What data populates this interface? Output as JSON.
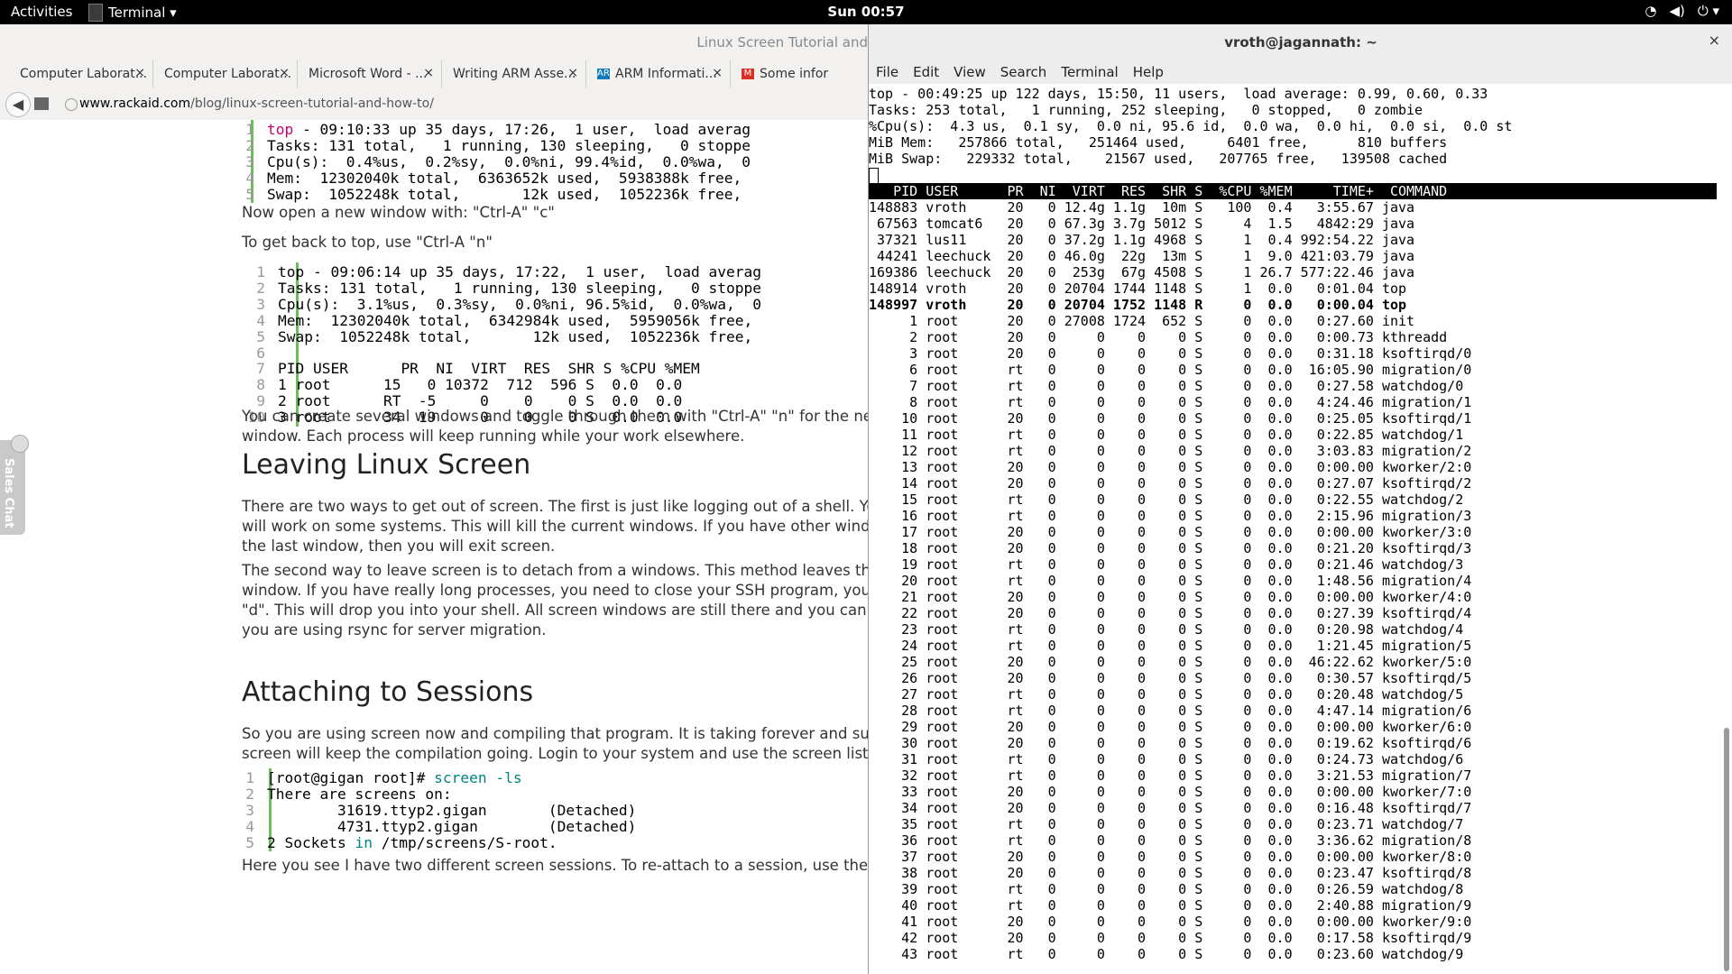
{
  "topbar": {
    "activities": "Activities",
    "app_name": "Terminal ▾",
    "clock": "Sun 00:57",
    "tray": [
      "wifi-icon",
      "volume-icon",
      "power-icon"
    ]
  },
  "browser": {
    "window_title": "Linux Screen Tutorial and",
    "tabs": [
      {
        "label": "Computer Laborat...",
        "fav": "",
        "fav_color": "#ffffff"
      },
      {
        "label": "Computer Laborat...",
        "fav": "",
        "fav_color": "#ffffff"
      },
      {
        "label": "Microsoft Word - ...",
        "fav": "",
        "fav_color": "#ffffff"
      },
      {
        "label": "Writing ARM Asse...",
        "fav": "",
        "fav_color": "#ffffff"
      },
      {
        "label": "ARM Informati...",
        "fav": "ARM",
        "fav_color": "#0e7ab8"
      },
      {
        "label": "Some infor",
        "fav": "M",
        "fav_color": "#d93025"
      }
    ],
    "close_glyph": "×",
    "url_host": "www.rackaid.com",
    "url_path": "/blog/linux-screen-tutorial-and-how-to/",
    "code1": [
      [
        "1",
        "top",
        " - 09:10:33 up 35 days, 17:26,  1 user,  load averag"
      ],
      [
        "2",
        "",
        "Tasks: 131 total,   1 running, 130 sleeping,   0 stoppe"
      ],
      [
        "3",
        "",
        "Cpu(s):  0.4%us,  0.2%sy,  0.0%ni, 99.4%id,  0.0%wa,  0"
      ],
      [
        "4",
        "",
        "Mem:  12302040k total,  6363652k used,  5938388k free,"
      ],
      [
        "5",
        "",
        "Swap:  1052248k total,       12k used,  1052236k free,"
      ]
    ],
    "p1": "Now open a new window with: \"Ctrl-A\" \"c\"",
    "p2": "To get back to top, use \"Ctrl-A \"n\"",
    "code2": [
      [
        "1",
        "top - 09:06:14 up 35 days, 17:22,  1 user,  load averag"
      ],
      [
        "2",
        "Tasks: 131 total,   1 running, 130 sleeping,   0 stoppe"
      ],
      [
        "3",
        "Cpu(s):  3.1%us,  0.3%sy,  0.0%ni, 96.5%id,  0.0%wa,  0"
      ],
      [
        "4",
        "Mem:  12302040k total,  6342984k used,  5959056k free,"
      ],
      [
        "5",
        "Swap:  1052248k total,       12k used,  1052236k free,"
      ],
      [
        "6",
        ""
      ],
      [
        "7",
        "PID USER      PR  NI  VIRT  RES  SHR S %CPU %MEM"
      ],
      [
        "8",
        "1 root      15   0 10372  712  596 S  0.0  0.0"
      ],
      [
        "9",
        "2 root      RT  -5     0    0    0 S  0.0  0.0"
      ],
      [
        "10",
        "3 root      34  19     0    0    0 S  0.0  0.0"
      ]
    ],
    "p3a": "You can create several windows and toggle through them with \"Ctrl-A\" \"n\" for the next windo",
    "p3b": "window. Each process will keep running while your work elsewhere.",
    "h_leaving": "Leaving Linux Screen",
    "p4": [
      "There are two ways to get out of screen. The first is just like logging out of a shell. You kill the",
      "will work on some systems. This will kill the current windows. If you have other windows, you",
      "the last window, then you will exit screen."
    ],
    "p5": [
      "The second way to leave screen is to detach from a windows. This method leaves the proces",
      "window. If you have really long processes, you need to close your SSH program, you can deta",
      "\"d\". This will drop you into your shell. All screen windows are still there and you can re-attach",
      "you are using rsync for server migration."
    ],
    "h_attach": "Attaching to Sessions",
    "p6": [
      "So you are using screen now and compiling that program. It is taking forever and suddenly y",
      "screen will keep the compilation going. Login to your system and use the screen listing tool t"
    ],
    "code3": [
      [
        "1",
        "[root@gigan root]# ",
        "screen -ls"
      ],
      [
        "2",
        "There are screens on:",
        ""
      ],
      [
        "3",
        "        31619.ttyp2.gigan       (Detached)",
        ""
      ],
      [
        "4",
        "        4731.ttyp2.gigan        (Detached)",
        ""
      ],
      [
        "5",
        "2 Sockets ",
        "in",
        " /tmp/screens/S-root."
      ]
    ],
    "p7": "Here you see I have two different screen sessions. To re-attach to a session, use the re-attac",
    "sales_chat": "Sales Chat"
  },
  "terminal": {
    "title": "vroth@jagannath: ~",
    "close": "×",
    "menu": [
      "File",
      "Edit",
      "View",
      "Search",
      "Terminal",
      "Help"
    ],
    "summary": [
      "top - 00:49:25 up 122 days, 15:50, 11 users,  load average: 0.99, 0.60, 0.33",
      "Tasks: 253 total,   1 running, 252 sleeping,   0 stopped,   0 zombie",
      "%Cpu(s):  4.3 us,  0.1 sy,  0.0 ni, 95.6 id,  0.0 wa,  0.0 hi,  0.0 si,  0.0 st",
      "MiB Mem:   257866 total,   251464 used,     6401 free,      810 buffers",
      "MiB Swap:   229332 total,    21567 used,   207765 free,   139508 cached"
    ],
    "header": "   PID USER      PR  NI  VIRT  RES  SHR S  %CPU %MEM     TIME+  COMMAND                                                  ",
    "rows": [
      "148883 vroth     20   0 12.4g 1.1g  10m S   100  0.4   3:55.67 java",
      " 67563 tomcat6   20   0 67.3g 3.7g 5012 S     4  1.5   4842:29 java",
      " 37321 lus11     20   0 37.2g 1.1g 4968 S     1  0.4 992:54.22 java",
      " 44241 leechuck  20   0 46.0g  22g  13m S     1  9.0 421:03.79 java",
      "169386 leechuck  20   0  253g  67g 4508 S     1 26.7 577:22.46 java",
      "148914 vroth     20   0 20704 1744 1148 S     1  0.0   0:01.04 top",
      "148997 vroth     20   0 20704 1752 1148 R     0  0.0   0:00.04 top",
      "     1 root      20   0 27008 1724  652 S     0  0.0   0:27.60 init",
      "     2 root      20   0     0    0    0 S     0  0.0   0:00.73 kthreadd",
      "     3 root      20   0     0    0    0 S     0  0.0   0:31.18 ksoftirqd/0",
      "     6 root      rt   0     0    0    0 S     0  0.0  16:05.90 migration/0",
      "     7 root      rt   0     0    0    0 S     0  0.0   0:27.58 watchdog/0",
      "     8 root      rt   0     0    0    0 S     0  0.0   4:24.46 migration/1",
      "    10 root      20   0     0    0    0 S     0  0.0   0:25.05 ksoftirqd/1",
      "    11 root      rt   0     0    0    0 S     0  0.0   0:22.85 watchdog/1",
      "    12 root      rt   0     0    0    0 S     0  0.0   3:03.83 migration/2",
      "    13 root      20   0     0    0    0 S     0  0.0   0:00.00 kworker/2:0",
      "    14 root      20   0     0    0    0 S     0  0.0   0:27.07 ksoftirqd/2",
      "    15 root      rt   0     0    0    0 S     0  0.0   0:22.55 watchdog/2",
      "    16 root      rt   0     0    0    0 S     0  0.0   2:15.96 migration/3",
      "    17 root      20   0     0    0    0 S     0  0.0   0:00.00 kworker/3:0",
      "    18 root      20   0     0    0    0 S     0  0.0   0:21.20 ksoftirqd/3",
      "    19 root      rt   0     0    0    0 S     0  0.0   0:21.46 watchdog/3",
      "    20 root      rt   0     0    0    0 S     0  0.0   1:48.56 migration/4",
      "    21 root      20   0     0    0    0 S     0  0.0   0:00.00 kworker/4:0",
      "    22 root      20   0     0    0    0 S     0  0.0   0:27.39 ksoftirqd/4",
      "    23 root      rt   0     0    0    0 S     0  0.0   0:20.98 watchdog/4",
      "    24 root      rt   0     0    0    0 S     0  0.0   1:21.45 migration/5",
      "    25 root      20   0     0    0    0 S     0  0.0  46:22.62 kworker/5:0",
      "    26 root      20   0     0    0    0 S     0  0.0   0:30.57 ksoftirqd/5",
      "    27 root      rt   0     0    0    0 S     0  0.0   0:20.48 watchdog/5",
      "    28 root      rt   0     0    0    0 S     0  0.0   4:47.14 migration/6",
      "    29 root      20   0     0    0    0 S     0  0.0   0:00.00 kworker/6:0",
      "    30 root      20   0     0    0    0 S     0  0.0   0:19.62 ksoftirqd/6",
      "    31 root      rt   0     0    0    0 S     0  0.0   0:24.73 watchdog/6",
      "    32 root      rt   0     0    0    0 S     0  0.0   3:21.53 migration/7",
      "    33 root      20   0     0    0    0 S     0  0.0   0:00.00 kworker/7:0",
      "    34 root      20   0     0    0    0 S     0  0.0   0:16.48 ksoftirqd/7",
      "    35 root      rt   0     0    0    0 S     0  0.0   0:23.71 watchdog/7",
      "    36 root      rt   0     0    0    0 S     0  0.0   3:36.62 migration/8",
      "    37 root      20   0     0    0    0 S     0  0.0   0:00.00 kworker/8:0",
      "    38 root      20   0     0    0    0 S     0  0.0   0:23.47 ksoftirqd/8",
      "    39 root      rt   0     0    0    0 S     0  0.0   0:26.59 watchdog/8",
      "    40 root      rt   0     0    0    0 S     0  0.0   2:40.88 migration/9",
      "    41 root      20   0     0    0    0 S     0  0.0   0:00.00 kworker/9:0",
      "    42 root      20   0     0    0    0 S     0  0.0   0:17.58 ksoftirqd/9",
      "    43 root      rt   0     0    0    0 S     0  0.0   0:23.60 watchdog/9"
    ],
    "bold_row_index": 6
  }
}
